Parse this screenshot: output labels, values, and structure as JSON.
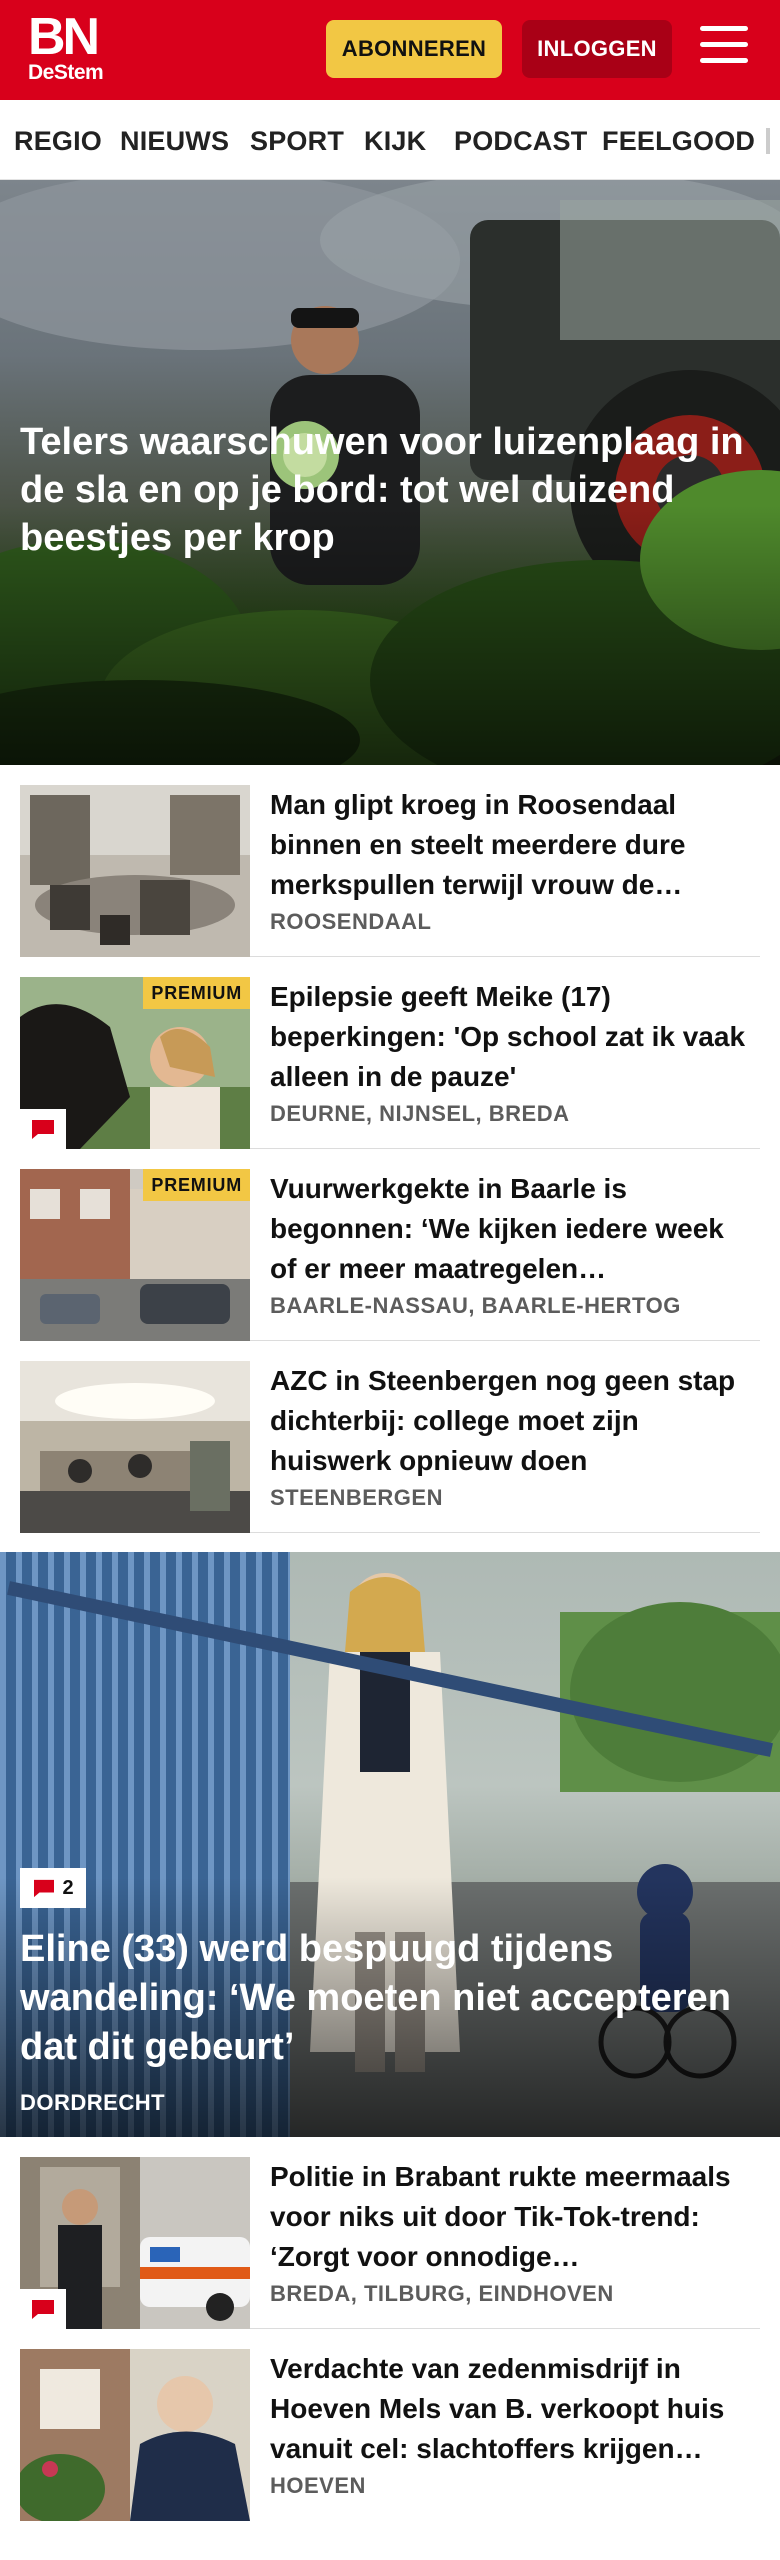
{
  "header": {
    "logo_main": "BN",
    "logo_sub": "DeStem",
    "subscribe_label": "ABONNEREN",
    "login_label": "INLOGGEN",
    "menu_icon": "hamburger-icon",
    "brand_color": "#d8001b"
  },
  "nav": {
    "items": [
      "REGIO",
      "NIEUWS",
      "SPORT",
      "KIJK",
      "PODCAST",
      "FEELGOOD"
    ]
  },
  "hero": {
    "title": "Telers waarschuwen voor luizenplaag in de sla en op je bord: tot wel duizend beestjes per krop"
  },
  "articles": [
    {
      "title": "Man glipt kroeg in Roosendaal binnen en steelt meerdere dure merkspullen terwijl vrouw de…",
      "location": "ROOSENDAAL"
    },
    {
      "title": "Epilepsie geeft Meike (17) beperkingen: 'Op school zat ik vaak alleen in de pauze'",
      "location": "DEURNE, NIJNSEL, BREDA",
      "badge": "PREMIUM",
      "comment_icon": "comment-icon"
    },
    {
      "title": "Vuurwerkgekte in Baarle is begonnen: ‘We kijken iedere week of er meer maatregelen…",
      "location": "BAARLE-NASSAU, BAARLE-HERTOG",
      "badge": "PREMIUM"
    },
    {
      "title": "AZC in Steenbergen nog geen stap dichterbij: college moet zijn huiswerk opnieuw doen",
      "location": "STEENBERGEN"
    }
  ],
  "feature": {
    "comment_count": "2",
    "title": "Eline (33) werd bespuugd tijdens wandeling: ‘We moeten niet accepteren dat dit gebeurt’",
    "location": "DORDRECHT"
  },
  "articles2": [
    {
      "title": "Politie in Brabant rukte meermaals voor niks uit door Tik-Tok-trend: ‘Zorgt voor onnodige…",
      "location": "BREDA, TILBURG, EINDHOVEN",
      "comment_icon": "comment-icon"
    },
    {
      "title": "Verdachte van zedenmisdrijf in Hoeven Mels van B. verkoopt huis vanuit cel: slachtoffers krijgen…",
      "location": "HOEVEN"
    }
  ]
}
